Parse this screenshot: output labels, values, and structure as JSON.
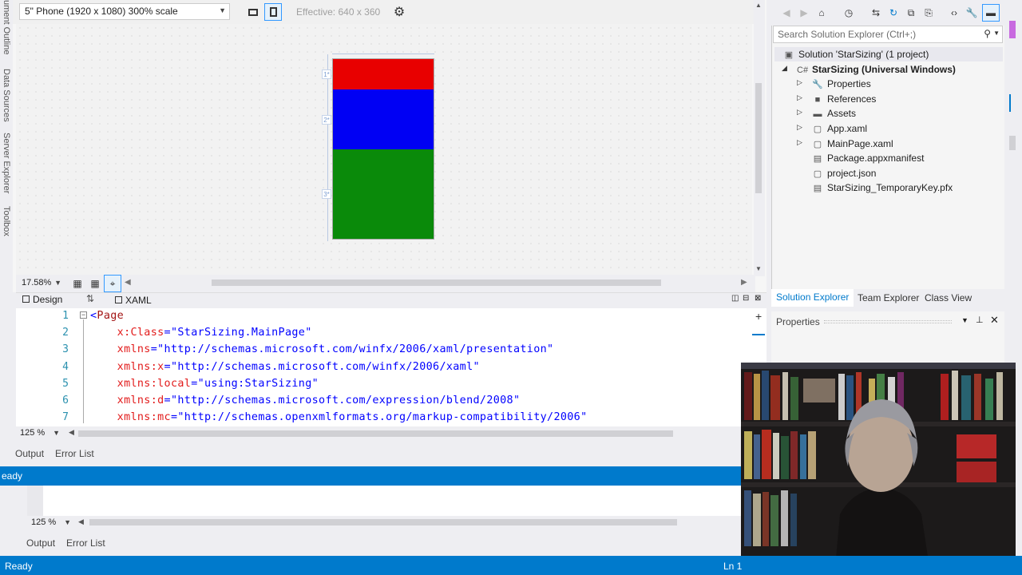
{
  "left_tabs": [
    "ument Outline",
    "Data Sources",
    "Server Explorer",
    "Toolbox"
  ],
  "designer": {
    "device_combo": "5\" Phone (1920 x 1080) 300% scale",
    "effective": "Effective: 640 x 360",
    "zoom": "17.58%",
    "rows": [
      {
        "color": "#e80000",
        "marker": "1*"
      },
      {
        "color": "#0000f4",
        "marker": "2*"
      },
      {
        "color": "#0a8a0a",
        "marker": "3*"
      }
    ]
  },
  "split": {
    "design_tab": "Design",
    "xaml_tab": "XAML"
  },
  "editor": {
    "zoom": "125 %",
    "lines": [
      {
        "num": "1",
        "indent": "",
        "parts": [
          {
            "t": "punct",
            "v": "<"
          },
          {
            "t": "tag",
            "v": "Page"
          }
        ]
      },
      {
        "num": "2",
        "indent": "    ",
        "parts": [
          {
            "t": "attr",
            "v": "x:Class"
          },
          {
            "t": "punct",
            "v": "="
          },
          {
            "t": "val",
            "v": "\"StarSizing.MainPage\""
          }
        ]
      },
      {
        "num": "3",
        "indent": "    ",
        "parts": [
          {
            "t": "attr",
            "v": "xmlns"
          },
          {
            "t": "punct",
            "v": "="
          },
          {
            "t": "val",
            "v": "\"http://schemas.microsoft.com/winfx/2006/xaml/presentation\""
          }
        ]
      },
      {
        "num": "4",
        "indent": "    ",
        "parts": [
          {
            "t": "attr",
            "v": "xmlns:x"
          },
          {
            "t": "punct",
            "v": "="
          },
          {
            "t": "val",
            "v": "\"http://schemas.microsoft.com/winfx/2006/xaml\""
          }
        ]
      },
      {
        "num": "5",
        "indent": "    ",
        "parts": [
          {
            "t": "attr",
            "v": "xmlns:local"
          },
          {
            "t": "punct",
            "v": "="
          },
          {
            "t": "val",
            "v": "\"using:StarSizing\""
          }
        ]
      },
      {
        "num": "6",
        "indent": "    ",
        "parts": [
          {
            "t": "attr",
            "v": "xmlns:d"
          },
          {
            "t": "punct",
            "v": "="
          },
          {
            "t": "val",
            "v": "\"http://schemas.microsoft.com/expression/blend/2008\""
          }
        ]
      },
      {
        "num": "7",
        "indent": "    ",
        "parts": [
          {
            "t": "attr",
            "v": "xmlns:mc"
          },
          {
            "t": "punct",
            "v": "="
          },
          {
            "t": "val",
            "v": "\"http://schemas.openxmlformats.org/markup-compatibility/2006\""
          }
        ]
      }
    ]
  },
  "output": {
    "tab_output": "Output",
    "tab_errors": "Error List",
    "status_partial": "eady",
    "inner_zoom": "125 %",
    "tab_output2": "Output",
    "tab_errors2": "Error List"
  },
  "solution_explorer": {
    "search_placeholder": "Search Solution Explorer (Ctrl+;)",
    "items": [
      {
        "label": "Solution 'StarSizing' (1 project)",
        "icon": "solution-icon",
        "glyph": "▣",
        "expander": ""
      },
      {
        "label": "StarSizing (Universal Windows)",
        "icon": "csharp-project-icon",
        "glyph": "C#",
        "expander": "◢",
        "bold": true
      },
      {
        "label": "Properties",
        "icon": "wrench-icon",
        "glyph": "🔧",
        "expander": "▷"
      },
      {
        "label": "References",
        "icon": "references-icon",
        "glyph": "■",
        "expander": "▷"
      },
      {
        "label": "Assets",
        "icon": "folder-icon",
        "glyph": "▬",
        "expander": "▷"
      },
      {
        "label": "App.xaml",
        "icon": "xaml-file-icon",
        "glyph": "▢",
        "expander": "▷"
      },
      {
        "label": "MainPage.xaml",
        "icon": "xaml-file-icon",
        "glyph": "▢",
        "expander": "▷"
      },
      {
        "label": "Package.appxmanifest",
        "icon": "manifest-icon",
        "glyph": "▤",
        "expander": ""
      },
      {
        "label": "project.json",
        "icon": "json-file-icon",
        "glyph": "▢",
        "expander": ""
      },
      {
        "label": "StarSizing_TemporaryKey.pfx",
        "icon": "certificate-icon",
        "glyph": "▤",
        "expander": ""
      }
    ],
    "tabs": [
      "Solution Explorer",
      "Team Explorer",
      "Class View"
    ],
    "properties_title": "Properties"
  },
  "status_bar": {
    "left": "Ready",
    "ln": "Ln 1"
  },
  "colors": {
    "accent": "#007acc",
    "red": "#e80000",
    "blue": "#0000f4",
    "green": "#0a8a0a"
  }
}
